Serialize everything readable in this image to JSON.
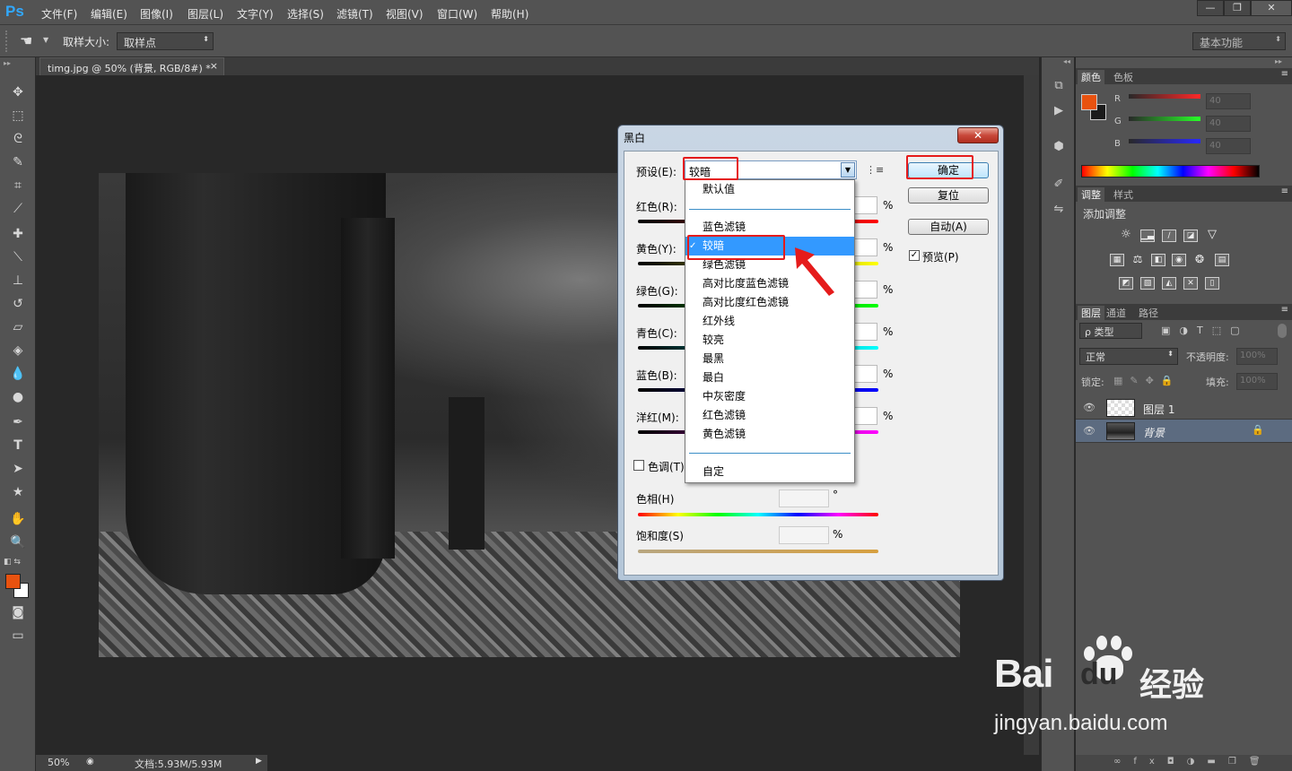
{
  "app": {
    "logo": "Ps"
  },
  "menu": [
    "文件(F)",
    "编辑(E)",
    "图像(I)",
    "图层(L)",
    "文字(Y)",
    "选择(S)",
    "滤镜(T)",
    "视图(V)",
    "窗口(W)",
    "帮助(H)"
  ],
  "window_controls": {
    "minimize": "—",
    "restore": "❐",
    "close": "✕"
  },
  "options": {
    "sample_label": "取样大小:",
    "sample_value": "取样点",
    "workspace": "基本功能"
  },
  "document": {
    "tab_title": "timg.jpg @ 50% (背景, RGB/8#) *",
    "tab_close": "×",
    "zoom": "50%",
    "doc_info": "文档:5.93M/5.93M"
  },
  "panels": {
    "color_tabs": [
      "颜色",
      "色板"
    ],
    "rgb": [
      {
        "label": "R",
        "value": "40"
      },
      {
        "label": "G",
        "value": "40"
      },
      {
        "label": "B",
        "value": "40"
      }
    ],
    "adjust_tabs": [
      "调整",
      "样式"
    ],
    "add_adjust": "添加调整",
    "layers_tabs": [
      "图层",
      "通道",
      "路径"
    ],
    "filter_kind": "ρ 类型",
    "blend_mode": "正常",
    "opacity_label": "不透明度:",
    "opacity_value": "100%",
    "lock_label": "锁定:",
    "fill_label": "填充:",
    "fill_value": "100%",
    "layers": [
      {
        "name": "图层 1"
      },
      {
        "name": "背景"
      }
    ]
  },
  "dialog": {
    "title": "黑白",
    "close": "✕",
    "preset_label": "预设(E):",
    "preset_value": "较暗",
    "sliders": [
      {
        "label": "红色(R):",
        "color": "#ff0000"
      },
      {
        "label": "黄色(Y):",
        "color": "#ffff00"
      },
      {
        "label": "绿色(G):",
        "color": "#00ff00"
      },
      {
        "label": "青色(C):",
        "color": "#00ffff"
      },
      {
        "label": "蓝色(B):",
        "color": "#0000ff"
      },
      {
        "label": "洋红(M):",
        "color": "#ff00ff"
      }
    ],
    "pct": "%",
    "tint_label": "色调(T)",
    "hue_label": "色相(H)",
    "hue_unit": "°",
    "sat_label": "饱和度(S)",
    "sat_unit": "%",
    "ok": "确定",
    "reset": "复位",
    "auto": "自动(A)",
    "preview": "预览(P)",
    "dropdown_items": [
      "默认值",
      "",
      "蓝色滤镜",
      "较暗",
      "绿色滤镜",
      "高对比度蓝色滤镜",
      "高对比度红色滤镜",
      "红外线",
      "较亮",
      "最黑",
      "最白",
      "中灰密度",
      "红色滤镜",
      "黄色滤镜",
      "",
      "自定"
    ],
    "checkmark": "✓"
  },
  "watermark": {
    "brand": "Bai",
    "brand2": "du",
    "cn": "经验",
    "url": "jingyan.baidu.com"
  }
}
